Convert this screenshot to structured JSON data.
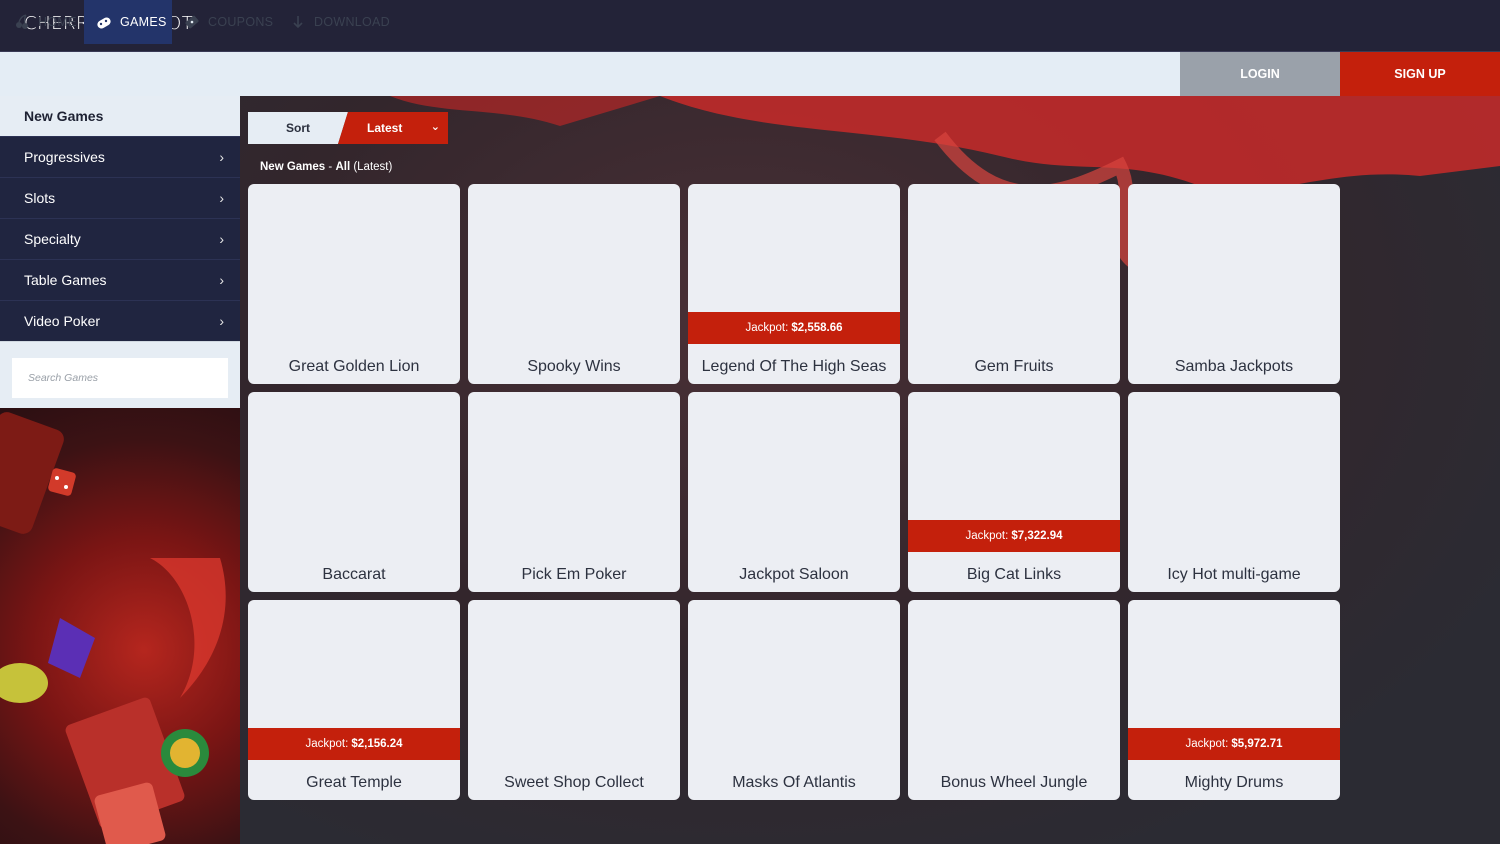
{
  "brand": {
    "logo_left": "CHERRY ",
    "logo_glyph": "♣",
    "logo_right": "ACKPOT"
  },
  "nav": {
    "home": "HOME",
    "games": "GAMES",
    "coupons": "COUPONS",
    "download": "DOWNLOAD",
    "login": "LOGIN",
    "signup": "SIGN UP"
  },
  "sidebar": {
    "header": "New Games",
    "items": [
      {
        "label": "Progressives"
      },
      {
        "label": "Slots"
      },
      {
        "label": "Specialty"
      },
      {
        "label": "Table Games"
      },
      {
        "label": "Video Poker"
      }
    ],
    "search_placeholder": "Search Games"
  },
  "sort": {
    "label": "Sort",
    "value": "Latest"
  },
  "section": {
    "category": "New Games",
    "separator": " - ",
    "filter": "All",
    "order": " (Latest)"
  },
  "jackpot_label": "Jackpot:",
  "games": [
    {
      "title": "Great Golden Lion"
    },
    {
      "title": "Spooky Wins"
    },
    {
      "title": "Legend Of The High Seas",
      "jackpot": "$2,558.66"
    },
    {
      "title": "Gem Fruits"
    },
    {
      "title": "Samba Jackpots"
    },
    {
      "title": "Baccarat"
    },
    {
      "title": "Pick Em Poker"
    },
    {
      "title": "Jackpot Saloon"
    },
    {
      "title": "Big Cat Links",
      "jackpot": "$7,322.94"
    },
    {
      "title": "Icy Hot multi-game"
    },
    {
      "title": "Great Temple",
      "jackpot": "$2,156.24"
    },
    {
      "title": "Sweet Shop Collect"
    },
    {
      "title": "Masks Of Atlantis"
    },
    {
      "title": "Bonus Wheel Jungle"
    },
    {
      "title": "Mighty Drums",
      "jackpot": "$5,972.71"
    }
  ],
  "colors": {
    "accent_red": "#c4200c",
    "nav_active": "#23346a",
    "header_bg": "#232338"
  }
}
